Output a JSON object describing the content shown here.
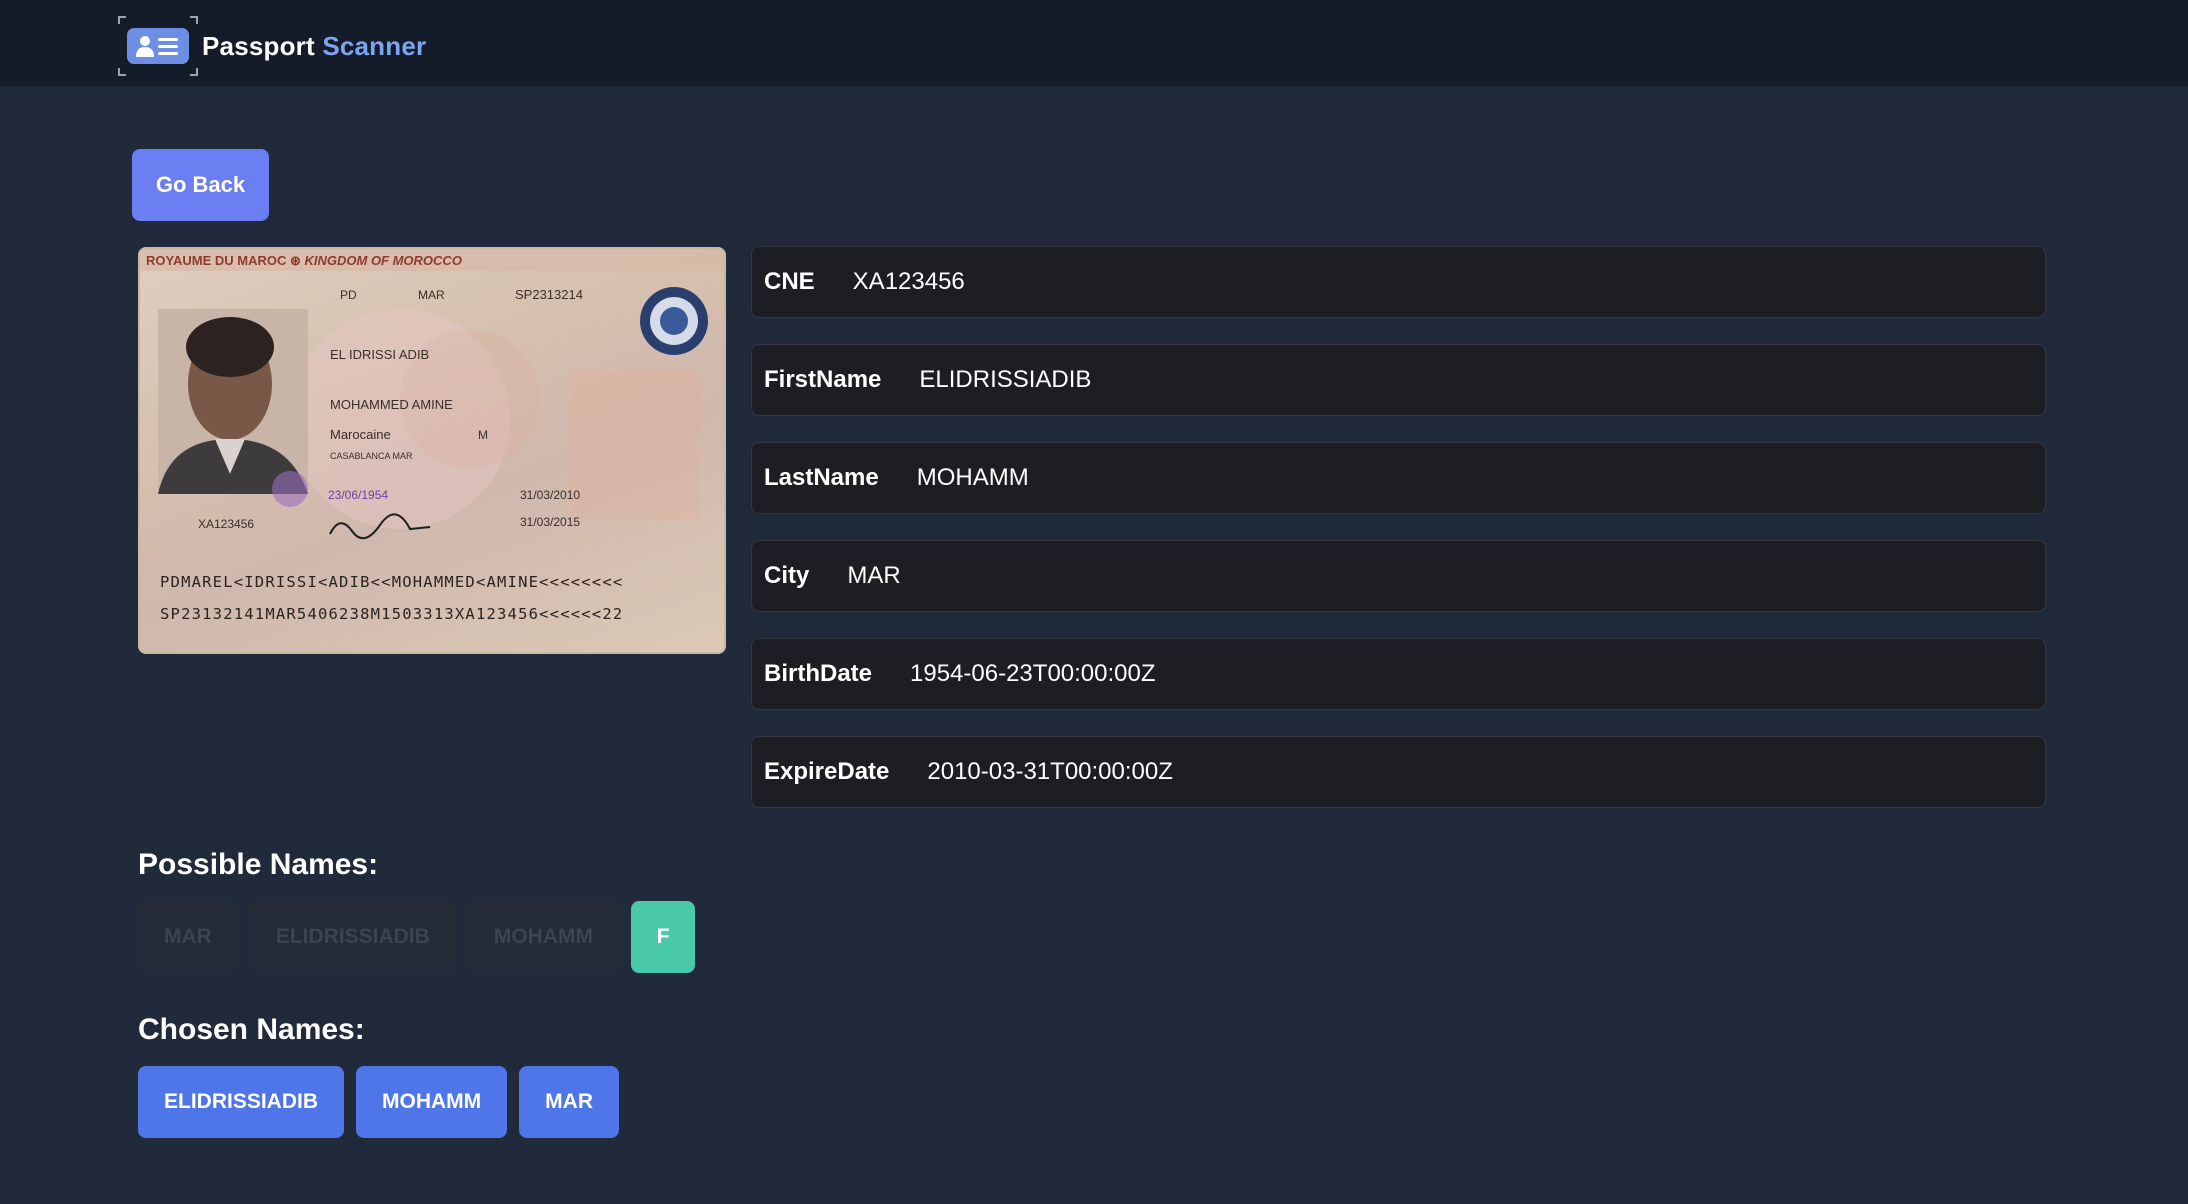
{
  "navbar": {
    "brand_word1": "Passport",
    "brand_word2": "Scanner",
    "logo_icon": "id-card-icon"
  },
  "actions": {
    "go_back_label": "Go Back"
  },
  "passport": {
    "header": "ROYAUME DU MAROC",
    "header_en": "KINGDOM OF MOROCCO",
    "type": "PD",
    "code": "MAR",
    "number": "SP2313214",
    "surname": "EL IDRISSI ADIB",
    "given_names": "MOHAMMED AMINE",
    "sex": "M",
    "nationality": "Marocaine",
    "birth_place": "CASABLANCA MAR",
    "birth_date": "23/06/1954",
    "issue_date": "31/03/2010",
    "expiry_date": "31/03/2015",
    "cnie": "XA123456",
    "mrz_line1": "PDMAREL<IDRISSI<ADIB<<MOHAMMED<AMINE<<<<<<<<",
    "mrz_line2": "SP23132141MAR5406238M1503313XA123456<<<<<<22"
  },
  "fields": [
    {
      "label": "CNE",
      "value": "XA123456"
    },
    {
      "label": "FirstName",
      "value": "ELIDRISSIADIB"
    },
    {
      "label": "LastName",
      "value": "MOHAMM"
    },
    {
      "label": "City",
      "value": "MAR"
    },
    {
      "label": "BirthDate",
      "value": "1954-06-23T00:00:00Z"
    },
    {
      "label": "ExpireDate",
      "value": "2010-03-31T00:00:00Z"
    }
  ],
  "possible_names": {
    "title": "Possible Names:",
    "items": [
      "MAR",
      "ELIDRISSIADIB",
      "MOHAMM",
      "F"
    ]
  },
  "chosen_names": {
    "title": "Chosen Names:",
    "items": [
      "ELIDRISSIADIB",
      "MOHAMM",
      "MAR"
    ]
  },
  "colors": {
    "background": "#202a3b",
    "navbar": "#151c29",
    "accent_purple": "#6c7ff2",
    "accent_blue": "#4e76e8",
    "accent_teal": "#49c9a8",
    "brand_blue": "#7ea3f1"
  }
}
